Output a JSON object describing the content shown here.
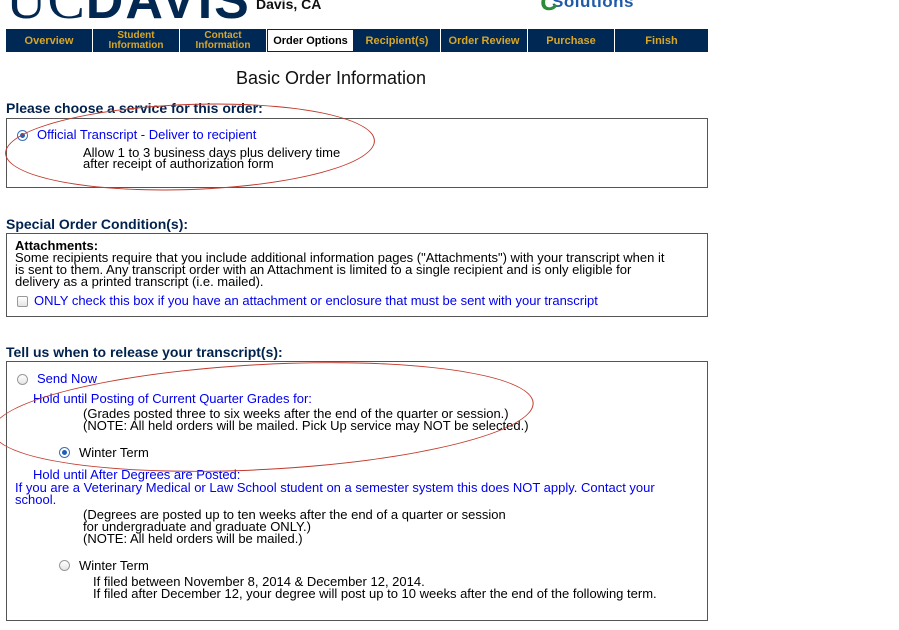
{
  "header": {
    "logo_regular": "UC",
    "logo_bold": "DAVIS",
    "location": "Davis, CA",
    "vendor_name": "Solutions"
  },
  "nav": {
    "tabs": [
      {
        "label": "Overview",
        "active": false
      },
      {
        "label": "Student Information",
        "active": false
      },
      {
        "label": "Contact Information",
        "active": false
      },
      {
        "label": "Order Options",
        "active": true
      },
      {
        "label": "Recipient(s)",
        "active": false
      },
      {
        "label": "Order Review",
        "active": false
      },
      {
        "label": "Purchase",
        "active": false
      },
      {
        "label": "Finish",
        "active": false
      }
    ]
  },
  "page_title": "Basic Order Information",
  "service": {
    "heading": "Please choose a service for this order:",
    "option_label": "Official Transcript - Deliver to recipient",
    "option_selected": true,
    "note_line1": "Allow 1 to 3 business days plus delivery time",
    "note_line2": "after receipt of authorization form"
  },
  "special": {
    "heading": "Special Order Condition(s):",
    "attachments_title": "Attachments:",
    "line1": "Some recipients require that you include additional information pages (\"Attachments\") with your transcript when it",
    "line2": "is sent to them. Any transcript order with an Attachment is limited to a single recipient and is only eligible for",
    "line3": "delivery as a printed transcript (i.e. mailed).",
    "checkbox_label": "ONLY check this box if you have an attachment or enclosure that must be sent with your transcript",
    "checked": false
  },
  "release": {
    "heading": "Tell us when to release your transcript(s):",
    "send_now": "Send Now",
    "hold_grades": "Hold until Posting of Current Quarter Grades for:",
    "grades_note1": "(Grades posted three to six weeks after the end of the quarter or session.)",
    "grades_note2": "(NOTE: All held orders will be mailed. Pick Up service may NOT be selected.)",
    "grades_term": "Winter Term",
    "grades_term_selected": true,
    "hold_degrees": "Hold until After Degrees are Posted:",
    "degrees_warn1": "If you are a Veterinary Medical or Law School student on a semester system this does NOT apply. Contact your",
    "degrees_warn2": "school.",
    "degrees_note1": "(Degrees are posted up to ten weeks after the end of a quarter or session",
    "degrees_note2": "for undergraduate and graduate ONLY.)",
    "degrees_note3": "(NOTE: All held orders will be mailed.)",
    "degrees_term": "Winter Term",
    "degrees_term_selected": false,
    "degrees_filed1": "If filed between November 8, 2014 & December 12, 2014.",
    "degrees_filed2": "If filed after December 12, your degree will post up to 10 weeks after the end of the following term."
  },
  "colors": {
    "nav_bg": "#002855",
    "nav_text": "#d9a625",
    "heading": "#00224d",
    "link_blue": "#0000ee",
    "annotation_red": "#c0392b"
  }
}
